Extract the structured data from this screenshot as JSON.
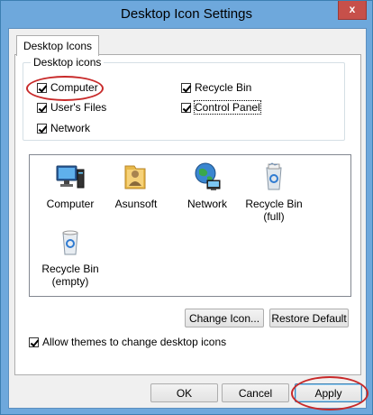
{
  "window": {
    "title": "Desktop Icon Settings",
    "close_glyph": "x"
  },
  "tab": {
    "label": "Desktop Icons"
  },
  "group": {
    "legend": "Desktop icons",
    "checkboxes": [
      {
        "label": "Computer",
        "checked": true
      },
      {
        "label": "User's Files",
        "checked": true
      },
      {
        "label": "Network",
        "checked": true
      },
      {
        "label": "Recycle Bin",
        "checked": true
      },
      {
        "label": "Control Panel",
        "checked": true
      }
    ]
  },
  "icons": [
    {
      "label": "Computer",
      "icon": "computer-icon"
    },
    {
      "label": "Asunsoft",
      "icon": "user-folder-icon"
    },
    {
      "label": "Network",
      "icon": "network-globe-icon"
    },
    {
      "label": "Recycle Bin\n(full)",
      "icon": "recycle-bin-full-icon"
    },
    {
      "label": "Recycle Bin\n(empty)",
      "icon": "recycle-bin-empty-icon"
    }
  ],
  "buttons": {
    "change_icon": "Change Icon...",
    "restore_default": "Restore Default",
    "ok": "OK",
    "cancel": "Cancel",
    "apply": "Apply"
  },
  "allow_themes": {
    "label": "Allow themes to change desktop icons",
    "checked": true
  },
  "colors": {
    "frame": "#6ea8dc",
    "client": "#f0f0f0",
    "highlight": "#c82a2a"
  }
}
